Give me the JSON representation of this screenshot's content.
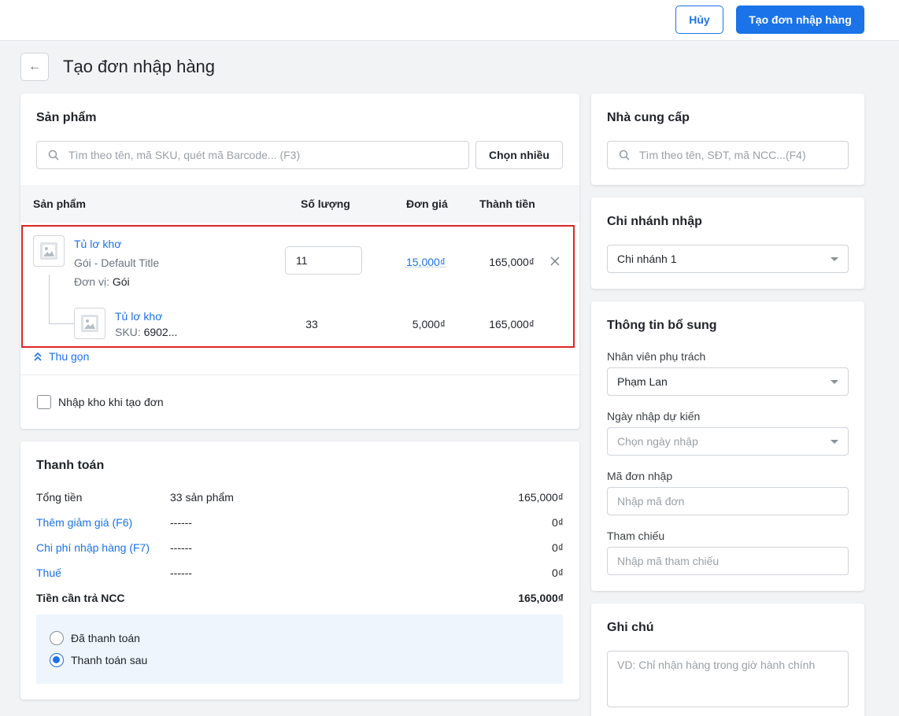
{
  "header": {
    "cancel_label": "Hủy",
    "create_label": "Tạo đơn nhập hàng"
  },
  "page": {
    "title": "Tạo đơn nhập hàng"
  },
  "products": {
    "title": "Sản phẩm",
    "search_placeholder": "Tìm theo tên, mã SKU, quét mã Barcode... (F3)",
    "choose_many_label": "Chọn nhiều",
    "columns": {
      "product": "Sản phẩm",
      "quantity": "Số lượng",
      "unit_price": "Đơn giá",
      "total": "Thành tiền"
    },
    "item": {
      "name": "Tủ lơ khơ",
      "variant": "Gói - Default Title",
      "unit_label": "Đơn vị:",
      "unit_value": "Gói",
      "quantity": "11",
      "unit_price": "15,000₫",
      "total": "165,000₫"
    },
    "sub_item": {
      "name": "Tủ lơ khơ",
      "sku_label": "SKU:",
      "sku_value": "6902...",
      "quantity": "33",
      "unit_price": "5,000₫",
      "total": "165,000₫"
    },
    "collapse_label": "Thu gọn",
    "stock_in_label": "Nhập kho khi tạo đơn"
  },
  "payment": {
    "title": "Thanh toán",
    "rows": [
      {
        "label": "Tổng tiền",
        "middle": "33 sản phẩm",
        "value": "165,000₫"
      },
      {
        "label": "Thêm giảm giá (F6)",
        "middle": "------",
        "value": "0₫"
      },
      {
        "label": "Chi phí nhập hàng (F7)",
        "middle": "------",
        "value": "0₫"
      },
      {
        "label": "Thuế",
        "middle": "------",
        "value": "0₫"
      },
      {
        "label": "Tiền cần trả NCC",
        "middle": "",
        "value": "165,000₫"
      }
    ],
    "options": [
      {
        "label": "Đã thanh toán",
        "selected": false
      },
      {
        "label": "Thanh toán sau",
        "selected": true
      }
    ]
  },
  "supplier": {
    "title": "Nhà cung cấp",
    "search_placeholder": "Tìm theo tên, SĐT, mã NCC...(F4)"
  },
  "branch": {
    "title": "Chi nhánh nhập",
    "value": "Chi nhánh 1"
  },
  "extra": {
    "title": "Thông tin bổ sung",
    "staff_label": "Nhân viên phụ trách",
    "staff_value": "Phạm Lan",
    "date_label": "Ngày nhập dự kiến",
    "date_placeholder": "Chọn ngày nhập",
    "code_label": "Mã đơn nhập",
    "code_placeholder": "Nhập mã đơn",
    "ref_label": "Tham chiếu",
    "ref_placeholder": "Nhập mã tham chiếu"
  },
  "note": {
    "title": "Ghi chú",
    "placeholder": "VD: Chỉ nhận hàng trong giờ hành chính"
  },
  "colors": {
    "primary": "#1a73e8",
    "highlight": "#e02424",
    "background": "#f2f3f5"
  }
}
